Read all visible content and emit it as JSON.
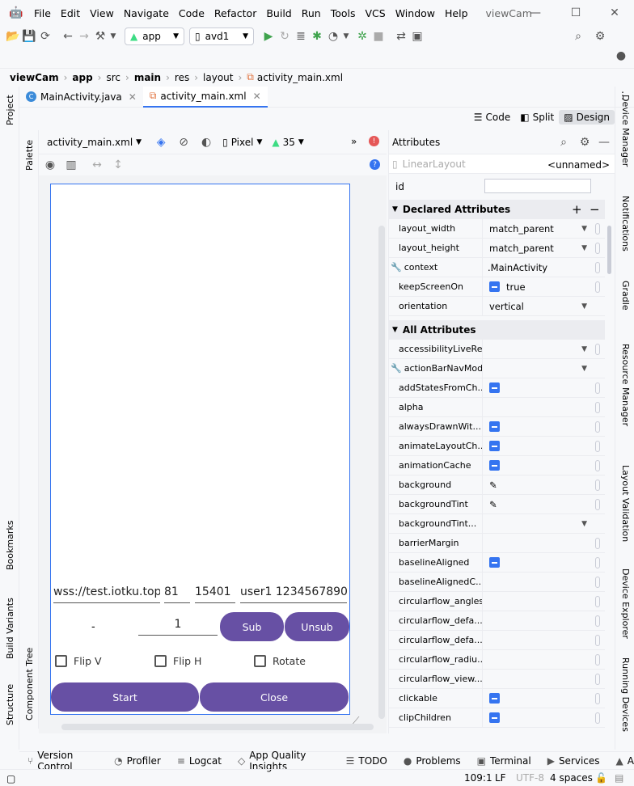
{
  "window": {
    "title": "viewCam"
  },
  "menu": [
    "File",
    "Edit",
    "View",
    "Navigate",
    "Code",
    "Refactor",
    "Build",
    "Run",
    "Tools",
    "VCS",
    "Window",
    "Help"
  ],
  "toolbar": {
    "run_config": "app",
    "device": "avd1"
  },
  "breadcrumb": [
    "viewCam",
    "app",
    "src",
    "main",
    "res",
    "layout",
    "activity_main.xml"
  ],
  "tabs": [
    {
      "label": "MainActivity.java"
    },
    {
      "label": "activity_main.xml"
    }
  ],
  "left_strip": {
    "project": "Project",
    "bookmarks": "Bookmarks",
    "build_variants": "Build Variants",
    "structure": "Structure"
  },
  "right_strip": {
    "device_manager": "Device Manager",
    "notifications": "Notifications",
    "gradle": "Gradle",
    "resource_manager": "Resource Manager",
    "layout_validation": "Layout Validation",
    "device_explorer": "Device Explorer",
    "running_devices": "Running Devices"
  },
  "palette_strip": {
    "palette": "Palette",
    "component_tree": "Component Tree"
  },
  "view_modes": {
    "code": "Code",
    "split": "Split",
    "design": "Design"
  },
  "design_toolbar": {
    "file": "activity_main.xml",
    "device": "Pixel",
    "api": "35",
    "more": "»"
  },
  "phone": {
    "fields": [
      "wss://test.iotku.top",
      "81",
      "15401",
      "user1 1234567890"
    ],
    "dash": "-",
    "counter": "1",
    "sub": "Sub",
    "unsub": "Unsub",
    "flip_v": "Flip V",
    "flip_h": "Flip H",
    "rotate": "Rotate",
    "start": "Start",
    "close": "Close",
    "colors": {
      "primary": "#6750a4"
    }
  },
  "attributes": {
    "title": "Attributes",
    "class": "LinearLayout",
    "unnamed": "<unnamed>",
    "id_label": "id",
    "declared_title": "Declared Attributes",
    "declared": [
      {
        "name": "layout_width",
        "value": "match_parent"
      },
      {
        "name": "layout_height",
        "value": "match_parent"
      },
      {
        "name": "context",
        "value": ".MainActivity"
      },
      {
        "name": "keepScreenOn",
        "value": "true"
      },
      {
        "name": "orientation",
        "value": "vertical"
      }
    ],
    "all_title": "All Attributes",
    "all": [
      "accessibilityLiveRe...",
      "actionBarNavMode",
      "addStatesFromCh...",
      "alpha",
      "alwaysDrawnWit...",
      "animateLayoutCh...",
      "animationCache",
      "background",
      "backgroundTint",
      "backgroundTint...",
      "barrierMargin",
      "baselineAligned",
      "baselineAlignedC...",
      "circularflow_angles",
      "circularflow_defa...",
      "circularflow_defa...",
      "circularflow_radiu...",
      "circularflow_view...",
      "clickable",
      "clipChildren"
    ]
  },
  "bottom_tools": [
    "Version Control",
    "Profiler",
    "Logcat",
    "App Quality Insights",
    "TODO",
    "Problems",
    "Terminal",
    "Services",
    "A"
  ],
  "status": {
    "position": "109:1",
    "line_ending": "LF",
    "encoding": "UTF-8",
    "indent": "4 spaces"
  }
}
